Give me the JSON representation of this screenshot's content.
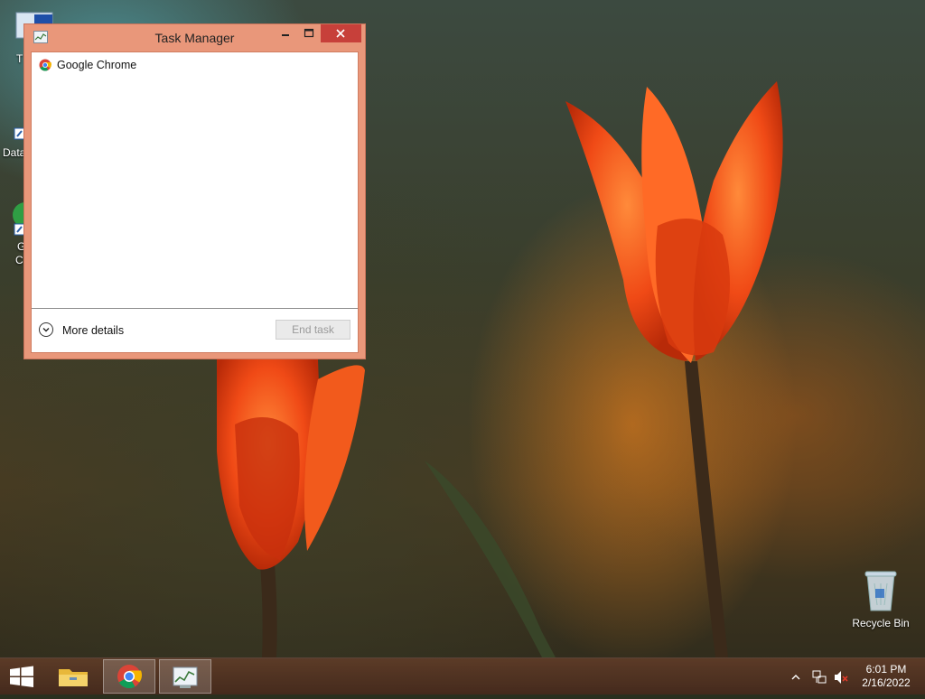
{
  "window": {
    "title": "Task Manager",
    "minimize_icon": "minimize-icon",
    "maximize_icon": "maximize-icon",
    "close_icon": "close-icon",
    "processes": [
      {
        "name": "Google Chrome",
        "icon": "chrome-icon"
      }
    ],
    "more_details_label": "More details",
    "end_task_label": "End task"
  },
  "desktop": {
    "icons": [
      {
        "label": "Recycle Bin",
        "icon": "recycle-bin-icon"
      }
    ],
    "partial_labels": [
      "T",
      "Data",
      "G",
      "C"
    ]
  },
  "taskbar": {
    "apps": [
      {
        "name": "File Explorer",
        "icon": "file-explorer-icon"
      },
      {
        "name": "Google Chrome",
        "icon": "chrome-icon"
      },
      {
        "name": "Task Manager",
        "icon": "task-manager-icon"
      }
    ],
    "clock": {
      "time": "6:01 PM",
      "date": "2/16/2022"
    }
  },
  "colors": {
    "window_frame": "#e9977a",
    "close_button": "#c7403a",
    "taskbar": "#5f3c28"
  }
}
